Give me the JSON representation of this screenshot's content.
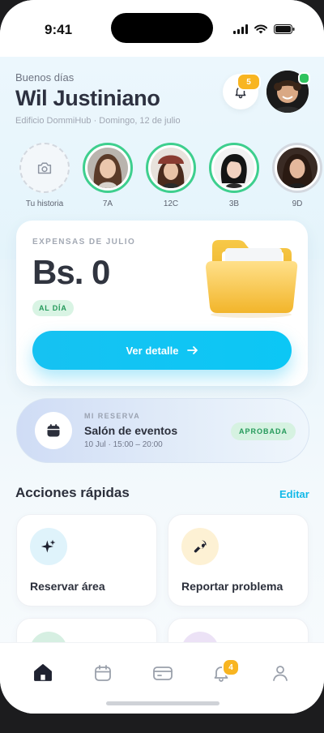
{
  "status_bar": {
    "time": "9:41"
  },
  "header": {
    "greeting": "Buenos días",
    "user_name": "Wil Justiniano",
    "subtitle": "Edificio DommiHub · Domingo, 12 de julio",
    "notification_count": "5"
  },
  "stories": [
    {
      "label": "Tu historia",
      "type": "add"
    },
    {
      "label": "7A",
      "type": "active"
    },
    {
      "label": "12C",
      "type": "active"
    },
    {
      "label": "3B",
      "type": "active"
    },
    {
      "label": "9D",
      "type": "seen"
    }
  ],
  "expenses_card": {
    "kicker": "EXPENSAS DE JULIO",
    "amount": "Bs. 0",
    "status": "AL DÍA",
    "button": "Ver detalle"
  },
  "reservation": {
    "kicker": "MI RESERVA",
    "title": "Salón de eventos",
    "time": "10 Jul · 15:00 – 20:00",
    "status": "APROBADA"
  },
  "quick_actions": {
    "title": "Acciones rápidas",
    "edit": "Editar",
    "items": [
      {
        "label": "Reservar área",
        "icon": "sparkle-icon",
        "bg": "#dff3fb"
      },
      {
        "label": "Reportar problema",
        "icon": "wrench-icon",
        "bg": "#fdf1d4"
      }
    ]
  },
  "tabbar": {
    "items": [
      "home-icon",
      "calendar-icon",
      "card-icon",
      "bell-icon",
      "user-icon"
    ],
    "notification_count": "4"
  },
  "colors": {
    "accent": "#12b9e8",
    "success": "#24995a",
    "warning": "#f8b521"
  }
}
